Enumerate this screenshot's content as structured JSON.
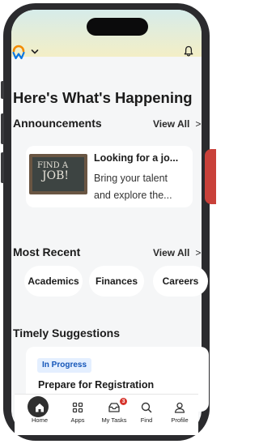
{
  "header": {
    "logo_icon": "workday-logo-icon",
    "menu_chevron_icon": "chevron-down-icon",
    "notifications_icon": "bell-icon"
  },
  "page_title": "Here's What's Happening",
  "announcements": {
    "title": "Announcements",
    "view_all": "View All",
    "card": {
      "image_text_line1": "FIND A",
      "image_text_line2": "JOB!",
      "title": "Looking for a jo...",
      "body_line1": "Bring your talent",
      "body_line2": "and explore the..."
    }
  },
  "most_recent": {
    "title": "Most Recent",
    "view_all": "View All",
    "chips": [
      "Academics",
      "Finances",
      "Careers"
    ]
  },
  "timely_suggestions": {
    "title": "Timely Suggestions",
    "card": {
      "badge": "In Progress",
      "title": "Prepare for Registration"
    }
  },
  "tabbar": {
    "tabs": [
      {
        "label": "Home",
        "icon": "home-icon"
      },
      {
        "label": "Apps",
        "icon": "apps-grid-icon"
      },
      {
        "label": "My Tasks",
        "icon": "inbox-icon",
        "badge": "3"
      },
      {
        "label": "Find",
        "icon": "search-icon"
      },
      {
        "label": "Profile",
        "icon": "person-icon"
      }
    ]
  },
  "colors": {
    "accent_orange": "#f38b00",
    "logo_blue": "#0875e1",
    "badge_bg": "#e4efff",
    "badge_text": "#1355b8",
    "notification_red": "#d6342c"
  }
}
